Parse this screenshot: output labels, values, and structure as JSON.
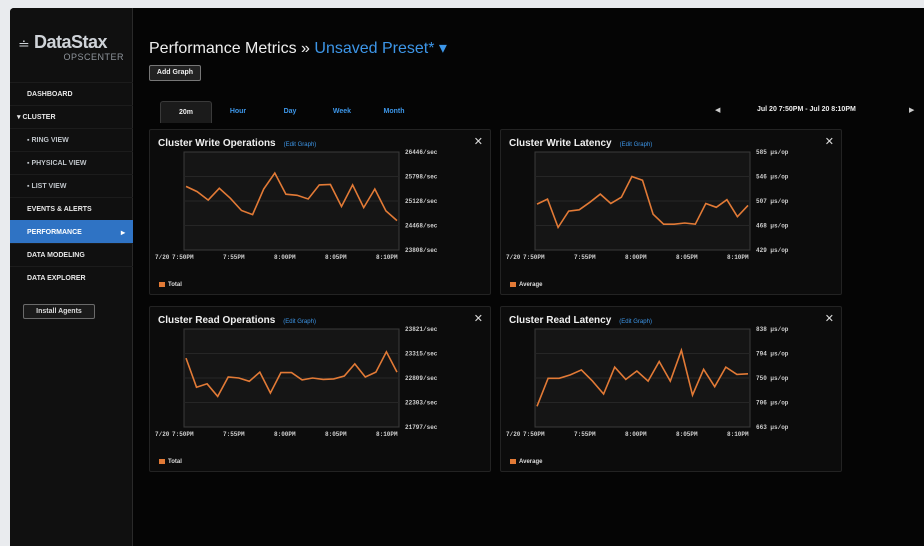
{
  "brand": {
    "name": "DataStax",
    "product": "OPSCENTER"
  },
  "sidebar": {
    "items": [
      {
        "label": "DASHBOARD",
        "kind": "top"
      },
      {
        "label": "CLUSTER",
        "kind": "top-cluster",
        "prefix": "▾"
      },
      {
        "label": "RING VIEW",
        "kind": "sub",
        "prefix": "▪"
      },
      {
        "label": "PHYSICAL VIEW",
        "kind": "sub",
        "prefix": "▪"
      },
      {
        "label": "LIST VIEW",
        "kind": "sub",
        "prefix": "▪"
      },
      {
        "label": "EVENTS & ALERTS",
        "kind": "top"
      },
      {
        "label": "PERFORMANCE",
        "kind": "top",
        "active": true
      },
      {
        "label": "DATA MODELING",
        "kind": "top"
      },
      {
        "label": "DATA EXPLORER",
        "kind": "top"
      }
    ],
    "install_label": "Install Agents"
  },
  "header": {
    "title": "Performance Metrics »",
    "preset": "Unsaved Preset*",
    "preset_caret": "▾",
    "add_graph": "Add Graph"
  },
  "range": {
    "tabs": [
      "20m",
      "Hour",
      "Day",
      "Week",
      "Month"
    ],
    "active": "20m",
    "prev": "◀",
    "next": "▶",
    "date_range": "Jul 20 7:50PM - Jul 20 8:10PM"
  },
  "colors": {
    "accent": "#3d96e8",
    "series": "#e27a36",
    "active_nav": "#2f73c4"
  },
  "charts": [
    {
      "title": "Cluster Write Operations",
      "edit": "(Edit Graph)",
      "close": "✕",
      "legend": "Total",
      "date": "7/20",
      "xticks": [
        "7:50PM",
        "7:55PM",
        "8:00PM",
        "8:05PM",
        "8:10PM"
      ],
      "yticks": [
        "26446/sec",
        "25798/sec",
        "25128/sec",
        "24468/sec",
        "23808/sec"
      ],
      "ylim": [
        23808,
        26446
      ],
      "values": [
        25520,
        25380,
        25150,
        25470,
        25200,
        24870,
        24760,
        25450,
        25880,
        25310,
        25280,
        25180,
        25560,
        25570,
        24980,
        25560,
        24950,
        25450,
        24860,
        24600
      ]
    },
    {
      "title": "Cluster Write Latency",
      "edit": "(Edit Graph)",
      "close": "✕",
      "legend": "Average",
      "date": "7/20",
      "xticks": [
        "7:50PM",
        "7:55PM",
        "8:00PM",
        "8:05PM",
        "8:10PM"
      ],
      "yticks": [
        "585 µs/op",
        "546 µs/op",
        "507 µs/op",
        "468 µs/op",
        "429 µs/op"
      ],
      "ylim": [
        429,
        585
      ],
      "values": [
        502,
        510,
        465,
        491,
        493,
        505,
        518,
        503,
        513,
        546,
        540,
        486,
        470,
        470,
        472,
        470,
        503,
        497,
        509,
        482,
        500
      ]
    },
    {
      "title": "Cluster Read Operations",
      "edit": "(Edit Graph)",
      "close": "✕",
      "legend": "Total",
      "date": "7/20",
      "xticks": [
        "7:50PM",
        "7:55PM",
        "8:00PM",
        "8:05PM",
        "8:10PM"
      ],
      "yticks": [
        "23821/sec",
        "23315/sec",
        "22809/sec",
        "22303/sec",
        "21797/sec"
      ],
      "ylim": [
        21797,
        23821
      ],
      "values": [
        23220,
        22620,
        22690,
        22430,
        22830,
        22810,
        22740,
        22930,
        22500,
        22920,
        22920,
        22770,
        22810,
        22780,
        22790,
        22850,
        23100,
        22830,
        22930,
        23350,
        22930
      ]
    },
    {
      "title": "Cluster Read Latency",
      "edit": "(Edit Graph)",
      "close": "✕",
      "legend": "Average",
      "date": "7/20",
      "xticks": [
        "7:50PM",
        "7:55PM",
        "8:00PM",
        "8:05PM",
        "8:10PM"
      ],
      "yticks": [
        "838 µs/op",
        "794 µs/op",
        "750 µs/op",
        "706 µs/op",
        "663 µs/op"
      ],
      "ylim": [
        663,
        838
      ],
      "values": [
        700,
        750,
        750,
        756,
        765,
        745,
        722,
        770,
        748,
        763,
        745,
        780,
        745,
        800,
        720,
        766,
        735,
        770,
        757,
        758
      ]
    }
  ]
}
